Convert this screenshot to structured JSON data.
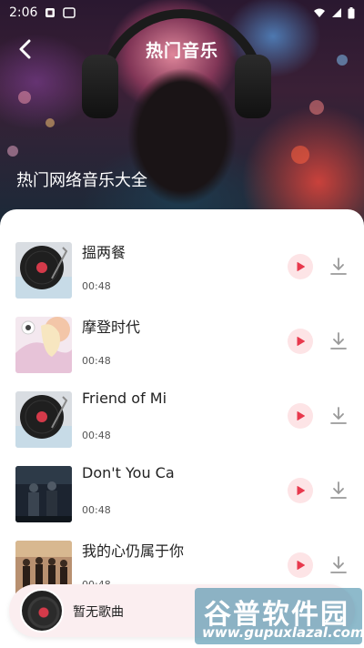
{
  "status_bar": {
    "time": "2:06"
  },
  "header": {
    "title": "热门音乐",
    "subtitle": "热门网络音乐大全"
  },
  "songs": [
    {
      "title": "搵两餐",
      "duration": "00:48",
      "cover": "vinyl"
    },
    {
      "title": "摩登时代",
      "duration": "00:48",
      "cover": "art-pastel"
    },
    {
      "title": "Friend of Mi",
      "duration": "00:48",
      "cover": "vinyl"
    },
    {
      "title": "Don't You Ca",
      "duration": "00:48",
      "cover": "photo-dark"
    },
    {
      "title": "我的心仍属于你",
      "duration": "00:48",
      "cover": "photo-warm"
    }
  ],
  "mini_player": {
    "text": "暂无歌曲"
  },
  "watermark": {
    "name": "谷普软件园",
    "url": "www.gupuxlazal.com"
  },
  "colors": {
    "accent": "#e8394d",
    "accent_bg": "#fde4e6",
    "mini_bg": "#fbeef0"
  }
}
